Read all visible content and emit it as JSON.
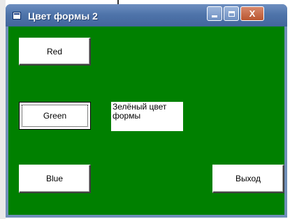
{
  "window": {
    "title": "Цвет формы 2",
    "client_color": "#008000"
  },
  "titlebar_buttons": {
    "close_glyph": "X"
  },
  "buttons": {
    "red_label": "Red",
    "green_label": "Green",
    "blue_label": "Blue",
    "exit_label": "Выход"
  },
  "label": {
    "text": "Зелёный цвет формы"
  },
  "colors": {
    "titlebar": "#4f74aa",
    "form_background": "#008000"
  }
}
